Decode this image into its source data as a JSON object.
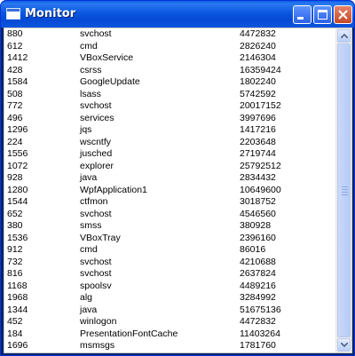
{
  "window": {
    "title": "Monitor"
  },
  "icons": {
    "app": "window-icon",
    "minimize": "minimize-icon",
    "maximize": "maximize-icon",
    "close": "close-icon"
  },
  "processes": [
    {
      "pid": "880",
      "name": "svchost",
      "mem": "4472832"
    },
    {
      "pid": "612",
      "name": "cmd",
      "mem": "2826240"
    },
    {
      "pid": "1412",
      "name": "VBoxService",
      "mem": "2146304"
    },
    {
      "pid": "428",
      "name": "csrss",
      "mem": "16359424"
    },
    {
      "pid": "1584",
      "name": "GoogleUpdate",
      "mem": "1802240"
    },
    {
      "pid": "508",
      "name": "lsass",
      "mem": "5742592"
    },
    {
      "pid": "772",
      "name": "svchost",
      "mem": "20017152"
    },
    {
      "pid": "496",
      "name": "services",
      "mem": "3997696"
    },
    {
      "pid": "1296",
      "name": "jqs",
      "mem": "1417216"
    },
    {
      "pid": "224",
      "name": "wscntfy",
      "mem": "2203648"
    },
    {
      "pid": "1556",
      "name": "jusched",
      "mem": "2719744"
    },
    {
      "pid": "1072",
      "name": "explorer",
      "mem": "25792512"
    },
    {
      "pid": "928",
      "name": "java",
      "mem": "2834432"
    },
    {
      "pid": "1280",
      "name": "WpfApplication1",
      "mem": "10649600"
    },
    {
      "pid": "1544",
      "name": "ctfmon",
      "mem": "3018752"
    },
    {
      "pid": "652",
      "name": "svchost",
      "mem": "4546560"
    },
    {
      "pid": "380",
      "name": "smss",
      "mem": "380928"
    },
    {
      "pid": "1536",
      "name": "VBoxTray",
      "mem": "2396160"
    },
    {
      "pid": "912",
      "name": "cmd",
      "mem": "86016"
    },
    {
      "pid": "732",
      "name": "svchost",
      "mem": "4210688"
    },
    {
      "pid": "816",
      "name": "svchost",
      "mem": "2637824"
    },
    {
      "pid": "1168",
      "name": "spoolsv",
      "mem": "4489216"
    },
    {
      "pid": "1968",
      "name": "alg",
      "mem": "3284992"
    },
    {
      "pid": "1344",
      "name": "java",
      "mem": "51675136"
    },
    {
      "pid": "452",
      "name": "winlogon",
      "mem": "4472832"
    },
    {
      "pid": "184",
      "name": "PresentationFontCache",
      "mem": "11403264"
    },
    {
      "pid": "1696",
      "name": "msmsgs",
      "mem": "1781760"
    }
  ]
}
